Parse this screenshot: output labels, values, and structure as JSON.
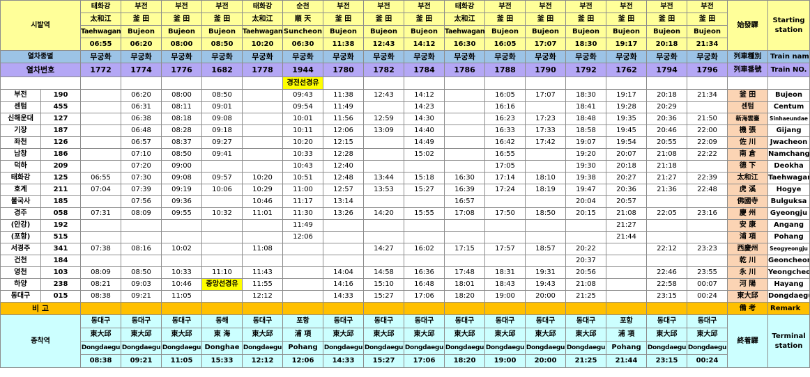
{
  "header": {
    "departure_label": "시발역",
    "departure_han": "始發驛",
    "departure_en": "Starting station",
    "train_type_label": "열차종별",
    "train_type_han": "列車種別",
    "train_type_en": "Train name",
    "train_no_label": "열차번호",
    "train_no_han": "列車番號",
    "train_no_en": "Train NO.",
    "remark_label": "비 고",
    "remark_han": "備 考",
    "remark_en": "Remark",
    "terminal_label": "종착역",
    "terminal_han": "終着驛",
    "terminal_en": "Terminal station"
  },
  "trains": [
    {
      "origin_ko": "태화강",
      "origin_han": "太和江",
      "origin_en": "Taehwagang",
      "dep": "06:55",
      "type": "무궁화",
      "no": "1772",
      "dest_ko": "동대구",
      "dest_han": "東大邱",
      "dest_en": "Dongdaegu",
      "arr": "08:38"
    },
    {
      "origin_ko": "부전",
      "origin_han": "釜 田",
      "origin_en": "Bujeon",
      "dep": "06:20",
      "type": "무궁화",
      "no": "1774",
      "dest_ko": "동대구",
      "dest_han": "東大邱",
      "dest_en": "Dongdaegu",
      "arr": "09:21"
    },
    {
      "origin_ko": "부전",
      "origin_han": "釜 田",
      "origin_en": "Bujeon",
      "dep": "08:00",
      "type": "무궁화",
      "no": "1776",
      "dest_ko": "동대구",
      "dest_han": "東大邱",
      "dest_en": "Dongdaegu",
      "arr": "11:05"
    },
    {
      "origin_ko": "부전",
      "origin_han": "釜 田",
      "origin_en": "Bujeon",
      "dep": "08:50",
      "type": "무궁화",
      "no": "1682",
      "dest_ko": "동해",
      "dest_han": "東 海",
      "dest_en": "Donghae",
      "arr": "15:33"
    },
    {
      "origin_ko": "태화강",
      "origin_han": "太和江",
      "origin_en": "Taehwagang",
      "dep": "10:20",
      "type": "무궁화",
      "no": "1778",
      "dest_ko": "동대구",
      "dest_han": "東大邱",
      "dest_en": "Dongdaegu",
      "arr": "12:12"
    },
    {
      "origin_ko": "순천",
      "origin_han": "順 天",
      "origin_en": "Suncheon",
      "dep": "06:30",
      "type": "무궁화",
      "no": "1944",
      "dest_ko": "포항",
      "dest_han": "浦 項",
      "dest_en": "Pohang",
      "arr": "12:06"
    },
    {
      "origin_ko": "부전",
      "origin_han": "釜 田",
      "origin_en": "Bujeon",
      "dep": "11:38",
      "type": "무궁화",
      "no": "1780",
      "dest_ko": "동대구",
      "dest_han": "東大邱",
      "dest_en": "Dongdaegu",
      "arr": "14:33"
    },
    {
      "origin_ko": "부전",
      "origin_han": "釜 田",
      "origin_en": "Bujeon",
      "dep": "12:43",
      "type": "무궁화",
      "no": "1782",
      "dest_ko": "동대구",
      "dest_han": "東大邱",
      "dest_en": "Dongdaegu",
      "arr": "15:27"
    },
    {
      "origin_ko": "부전",
      "origin_han": "釜 田",
      "origin_en": "Bujeon",
      "dep": "14:12",
      "type": "무궁화",
      "no": "1784",
      "dest_ko": "동대구",
      "dest_han": "東大邱",
      "dest_en": "Dongdaegu",
      "arr": "17:06"
    },
    {
      "origin_ko": "태화강",
      "origin_han": "太和江",
      "origin_en": "Taehwagang",
      "dep": "16:30",
      "type": "무궁화",
      "no": "1786",
      "dest_ko": "동대구",
      "dest_han": "東大邱",
      "dest_en": "Dongdaegu",
      "arr": "18:20"
    },
    {
      "origin_ko": "부전",
      "origin_han": "釜 田",
      "origin_en": "Bujeon",
      "dep": "16:05",
      "type": "무궁화",
      "no": "1788",
      "dest_ko": "동대구",
      "dest_han": "東大邱",
      "dest_en": "Dongdaegu",
      "arr": "19:00"
    },
    {
      "origin_ko": "부전",
      "origin_han": "釜 田",
      "origin_en": "Bujeon",
      "dep": "17:07",
      "type": "무궁화",
      "no": "1790",
      "dest_ko": "동대구",
      "dest_han": "東大邱",
      "dest_en": "Dongdaegu",
      "arr": "20:00"
    },
    {
      "origin_ko": "부전",
      "origin_han": "釜 田",
      "origin_en": "Bujeon",
      "dep": "18:30",
      "type": "무궁화",
      "no": "1792",
      "dest_ko": "동대구",
      "dest_han": "東大邱",
      "dest_en": "Dongdaegu",
      "arr": "21:25"
    },
    {
      "origin_ko": "부전",
      "origin_han": "釜 田",
      "origin_en": "Bujeon",
      "dep": "19:17",
      "type": "무궁화",
      "no": "1762",
      "dest_ko": "포항",
      "dest_han": "浦 項",
      "dest_en": "Pohang",
      "arr": "21:44"
    },
    {
      "origin_ko": "부전",
      "origin_han": "釜 田",
      "origin_en": "Bujeon",
      "dep": "20:18",
      "type": "무궁화",
      "no": "1794",
      "dest_ko": "동대구",
      "dest_han": "東大邱",
      "dest_en": "Dongdaegu",
      "arr": "23:15"
    },
    {
      "origin_ko": "부전",
      "origin_han": "釜 田",
      "origin_en": "Bujeon",
      "dep": "21:34",
      "type": "무궁화",
      "no": "1796",
      "dest_ko": "동대구",
      "dest_han": "東大邱",
      "dest_en": "Dongdaegu",
      "arr": "00:24"
    }
  ],
  "via_notes": {
    "row_label": "경전선경유",
    "row_train_index": 5
  },
  "stations": [
    {
      "ko": "부전",
      "dist": "190",
      "han": "釜 田",
      "en": "Bujeon",
      "times": [
        "",
        "06:20",
        "08:00",
        "08:50",
        "",
        "09:43",
        "11:38",
        "12:43",
        "14:12",
        "",
        "16:05",
        "17:07",
        "18:30",
        "19:17",
        "20:18",
        "21:34"
      ]
    },
    {
      "ko": "센텀",
      "dist": "455",
      "han": "센텀",
      "en": "Centum",
      "times": [
        "",
        "06:31",
        "08:11",
        "09:01",
        "",
        "09:54",
        "11:49",
        "",
        "14:23",
        "",
        "16:16",
        "",
        "18:41",
        "19:28",
        "20:29",
        ""
      ]
    },
    {
      "ko": "신해운대",
      "dist": "127",
      "han": "新海雲臺",
      "en": "Sinhaeundae",
      "times": [
        "",
        "06:38",
        "08:18",
        "09:08",
        "",
        "10:01",
        "11:56",
        "12:59",
        "14:30",
        "",
        "16:23",
        "17:23",
        "18:48",
        "19:35",
        "20:36",
        "21:50"
      ]
    },
    {
      "ko": "기장",
      "dist": "187",
      "han": "機 張",
      "en": "Gijang",
      "times": [
        "",
        "06:48",
        "08:28",
        "09:18",
        "",
        "10:11",
        "12:06",
        "13:09",
        "14:40",
        "",
        "16:33",
        "17:33",
        "18:58",
        "19:45",
        "20:46",
        "22:00"
      ]
    },
    {
      "ko": "좌천",
      "dist": "126",
      "han": "佐 川",
      "en": "Jwacheon",
      "times": [
        "",
        "06:57",
        "08:37",
        "09:27",
        "",
        "10:20",
        "12:15",
        "",
        "14:49",
        "",
        "16:42",
        "17:42",
        "19:07",
        "19:54",
        "20:55",
        "22:09"
      ]
    },
    {
      "ko": "남창",
      "dist": "186",
      "han": "南 倉",
      "en": "Namchang",
      "times": [
        "",
        "07:10",
        "08:50",
        "09:41",
        "",
        "10:33",
        "12:28",
        "",
        "15:02",
        "",
        "16:55",
        "",
        "19:20",
        "20:07",
        "21:08",
        "22:22"
      ]
    },
    {
      "ko": "덕하",
      "dist": "209",
      "han": "德 下",
      "en": "Deokha",
      "times": [
        "",
        "07:20",
        "09:00",
        "",
        "",
        "10:43",
        "12:40",
        "",
        "",
        "",
        "17:05",
        "",
        "19:30",
        "20:18",
        "21:18",
        ""
      ]
    },
    {
      "ko": "태화강",
      "dist": "125",
      "han": "太和江",
      "en": "Taehwagang",
      "times": [
        "06:55",
        "07:30",
        "09:08",
        "09:57",
        "10:20",
        "10:51",
        "12:48",
        "13:44",
        "15:18",
        "16:30",
        "17:14",
        "18:10",
        "19:38",
        "20:27",
        "21:27",
        "22:39"
      ]
    },
    {
      "ko": "호계",
      "dist": "211",
      "han": "虎 溪",
      "en": "Hogye",
      "times": [
        "07:04",
        "07:39",
        "09:19",
        "10:06",
        "10:29",
        "11:00",
        "12:57",
        "13:53",
        "15:27",
        "16:39",
        "17:24",
        "18:19",
        "19:47",
        "20:36",
        "21:36",
        "22:48"
      ]
    },
    {
      "ko": "불국사",
      "dist": "185",
      "han": "佛國寺",
      "en": "Bulguksa",
      "times": [
        "",
        "07:56",
        "09:36",
        "",
        "10:46",
        "11:17",
        "13:14",
        "",
        "",
        "16:57",
        "",
        "",
        "20:04",
        "20:57",
        "",
        ""
      ]
    },
    {
      "ko": "경주",
      "dist": "058",
      "han": "慶 州",
      "en": "Gyeongju",
      "times": [
        "07:31",
        "08:09",
        "09:55",
        "10:32",
        "11:01",
        "11:30",
        "13:26",
        "14:20",
        "15:55",
        "17:08",
        "17:50",
        "18:50",
        "20:15",
        "21:08",
        "22:05",
        "23:16"
      ]
    },
    {
      "ko": "(안강)",
      "dist": "192",
      "han": "安 康",
      "en": "Angang",
      "times": [
        "",
        "",
        "",
        "",
        "",
        "11:49",
        "",
        "",
        "",
        "",
        "",
        "",
        "",
        "21:27",
        "",
        ""
      ]
    },
    {
      "ko": "(포항)",
      "dist": "515",
      "han": "浦 項",
      "en": "Pohang",
      "times": [
        "",
        "",
        "",
        "",
        "",
        "12:06",
        "",
        "",
        "",
        "",
        "",
        "",
        "",
        "21:44",
        "",
        ""
      ]
    },
    {
      "ko": "서경주",
      "dist": "341",
      "han": "西慶州",
      "en": "Seogyeongju",
      "times": [
        "07:38",
        "08:16",
        "10:02",
        "",
        "11:08",
        "",
        "",
        "14:27",
        "16:02",
        "17:15",
        "17:57",
        "18:57",
        "20:22",
        "",
        "22:12",
        "23:23"
      ]
    },
    {
      "ko": "건천",
      "dist": "184",
      "han": "乾 川",
      "en": "Geoncheon",
      "times": [
        "",
        "",
        "",
        "",
        "",
        "",
        "",
        "",
        "",
        "",
        "",
        "",
        "20:37",
        "",
        "",
        ""
      ]
    },
    {
      "ko": "영천",
      "dist": "103",
      "han": "永 川",
      "en": "Yeongcheon",
      "times": [
        "08:09",
        "08:50",
        "10:33",
        "11:10",
        "11:43",
        "",
        "14:04",
        "14:58",
        "16:36",
        "17:48",
        "18:31",
        "19:31",
        "20:56",
        "",
        "22:46",
        "23:55"
      ]
    },
    {
      "ko": "하양",
      "dist": "238",
      "han": "河 陽",
      "en": "Hayang",
      "times": [
        "08:21",
        "09:03",
        "10:46",
        "중앙선경유",
        "11:55",
        "",
        "14:16",
        "15:10",
        "16:48",
        "18:01",
        "18:43",
        "19:43",
        "21:08",
        "",
        "22:58",
        "00:07"
      ]
    },
    {
      "ko": "동대구",
      "dist": "015",
      "han": "東大邱",
      "en": "Dongdaegu",
      "times": [
        "08:38",
        "09:21",
        "11:05",
        "",
        "12:12",
        "",
        "14:33",
        "15:27",
        "17:06",
        "18:20",
        "19:00",
        "20:00",
        "21:25",
        "",
        "23:15",
        "00:24"
      ]
    }
  ],
  "colors": {
    "header_yellow": "#ffff99",
    "type_blue": "#9cc3e6",
    "no_purple": "#b4a7f5",
    "remark_orange": "#ffc000",
    "terminal_cyan": "#ccffff",
    "station_peach": "#fbd4b4",
    "via_yellow": "#ffff00"
  }
}
